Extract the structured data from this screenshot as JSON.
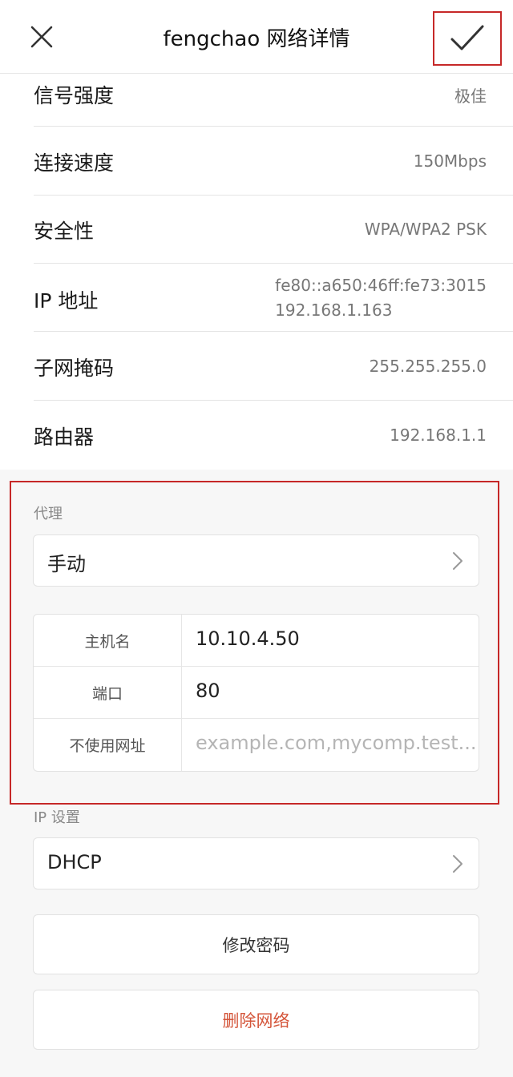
{
  "header": {
    "title": "fengchao  网络详情"
  },
  "info_rows": [
    {
      "label": "信号强度",
      "value": "极佳"
    },
    {
      "label": "连接速度",
      "value": "150Mbps"
    },
    {
      "label": "安全性",
      "value": "WPA/WPA2 PSK"
    },
    {
      "label": "IP 地址",
      "value_line1": "fe80::a650:46ff:fe73:3015",
      "value_line2": "192.168.1.163"
    },
    {
      "label": "子网掩码",
      "value": "255.255.255.0"
    },
    {
      "label": "路由器",
      "value": "192.168.1.1"
    }
  ],
  "proxy": {
    "section_label": "代理",
    "mode": "手动",
    "fields": [
      {
        "label": "主机名",
        "value": "10.10.4.50",
        "placeholder": ""
      },
      {
        "label": "端口",
        "value": "80",
        "placeholder": ""
      },
      {
        "label": "不使用网址",
        "value": "",
        "placeholder": "example.com,mycomp.test...."
      }
    ]
  },
  "ip_settings": {
    "section_label": "IP 设置",
    "mode": "DHCP"
  },
  "actions": {
    "change_password": "修改密码",
    "delete_network": "删除网络"
  },
  "colors": {
    "highlight_border": "#c62828",
    "danger_text": "#d4553a"
  }
}
